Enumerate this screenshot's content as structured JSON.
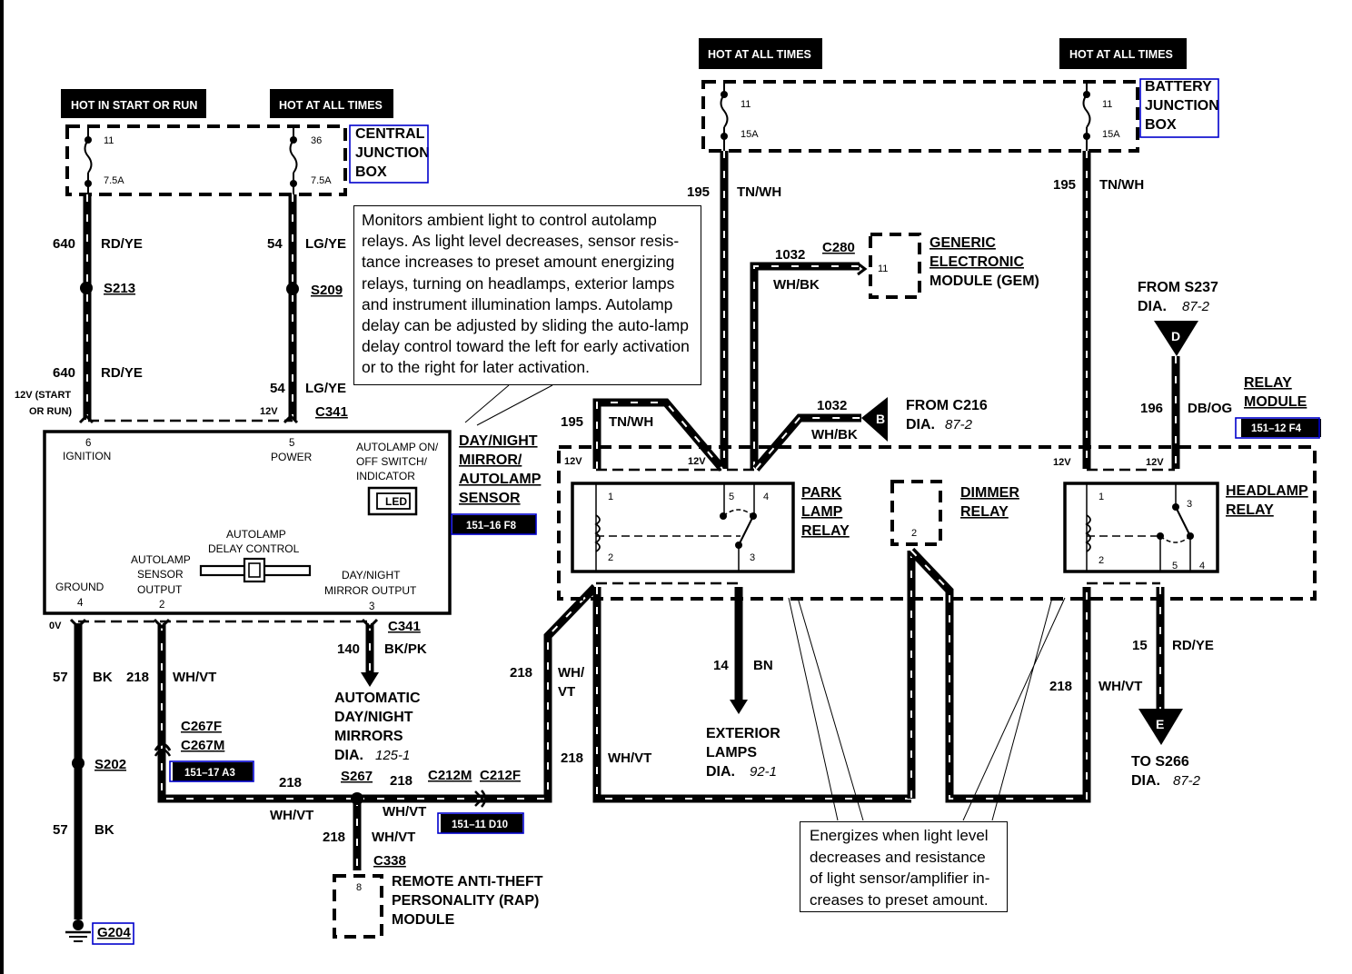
{
  "diagram": {
    "type": "automotive wiring schematic",
    "subject": "Autolamp / Day-Night Mirror / Autolamp Sensor circuit"
  },
  "power_labels": {
    "hot_start_run": "HOT IN START OR RUN",
    "hot_all_times_1": "HOT AT ALL TIMES",
    "hot_all_times_2": "HOT AT ALL TIMES",
    "hot_all_times_3": "HOT AT ALL TIMES"
  },
  "central_junction_box": {
    "name_lines": [
      "CENTRAL",
      "JUNCTION",
      "BOX"
    ],
    "fuses": [
      {
        "number": "11",
        "rating": "7.5A"
      },
      {
        "number": "36",
        "rating": "7.5A"
      }
    ]
  },
  "battery_junction_box": {
    "name_lines": [
      "BATTERY",
      "JUNCTION",
      "BOX"
    ],
    "fuses": [
      {
        "number": "11",
        "rating": "15A"
      },
      {
        "number": "11",
        "rating": "15A"
      }
    ]
  },
  "wires": {
    "w640_top": {
      "circuit": "640",
      "color": "RD/YE"
    },
    "w640_bot": {
      "circuit": "640",
      "color": "RD/YE"
    },
    "w54_top": {
      "circuit": "54",
      "color": "LG/YE"
    },
    "w54_bot": {
      "circuit": "54",
      "color": "LG/YE"
    },
    "w195_left": {
      "circuit": "195",
      "color": "TN/WH"
    },
    "w195_right": {
      "circuit": "195",
      "color": "TN/WH"
    },
    "w195_relay": {
      "circuit": "195",
      "color": "TN/WH"
    },
    "w1032_gem": {
      "circuit": "1032",
      "color": "WH/BK"
    },
    "w1032_b": {
      "circuit": "1032",
      "color": "WH/BK"
    },
    "w196": {
      "circuit": "196",
      "color": "DB/OG"
    },
    "w57_top": {
      "circuit": "57",
      "color": "BK"
    },
    "w57_bot": {
      "circuit": "57",
      "color": "BK"
    },
    "w218_sensor": {
      "circuit": "218",
      "color": "WH/VT"
    },
    "w140": {
      "circuit": "140",
      "color": "BK/PK"
    },
    "w218_bus_left": {
      "circuit": "218",
      "color": "WH/VT"
    },
    "w218_bus_right": {
      "circuit": "218",
      "color": "WH/VT"
    },
    "w218_rap": {
      "circuit": "218",
      "color": "WH/VT"
    },
    "w218_riser": {
      "circuit": "218",
      "color_lines": [
        "WH/",
        "VT"
      ]
    },
    "w218_park": {
      "circuit": "218",
      "color": "WH/VT"
    },
    "w14": {
      "circuit": "14",
      "color": "BN"
    },
    "w218_head": {
      "circuit": "218",
      "color": "WH/VT"
    },
    "w15": {
      "circuit": "15",
      "color": "RD/YE"
    }
  },
  "splices": {
    "s213": "S213",
    "s209": "S209",
    "s202": "S202",
    "s267": "S267"
  },
  "connectors": {
    "c341_top": "C341",
    "c341_bot": "C341",
    "c280": "C280",
    "c267f": "C267F",
    "c267m": "C267M",
    "c212m": "C212M",
    "c212f": "C212F",
    "c338": "C338"
  },
  "voltage_labels": {
    "start_run_l1": "12V (START",
    "start_run_l2": "OR RUN)",
    "v12_power": "12V",
    "v0_ground": "0V",
    "v12_park_a": "12V",
    "v12_park_b": "12V",
    "v12_head_a": "12V",
    "v12_head_b": "12V"
  },
  "sensor_module": {
    "name_lines": [
      "DAY/NIGHT",
      "MIRROR/",
      "AUTOLAMP",
      "SENSOR"
    ],
    "ref_tag": "151–16 F8",
    "pins": {
      "ignition": {
        "num": "6",
        "label": "IGNITION"
      },
      "power": {
        "num": "5",
        "label": "POWER"
      },
      "ground": {
        "num": "4",
        "label": "GROUND"
      },
      "sensor_output": {
        "num": "2",
        "label_lines": [
          "AUTOLAMP",
          "SENSOR",
          "OUTPUT"
        ]
      },
      "mirror_output": {
        "num": "3",
        "label_lines": [
          "DAY/NIGHT",
          "MIRROR  OUTPUT"
        ]
      }
    },
    "switch_label_lines": [
      "AUTOLAMP ON/",
      "OFF SWITCH/",
      "INDICATOR"
    ],
    "led_label": "LED",
    "delay_label_lines": [
      "AUTOLAMP",
      "DELAY  CONTROL"
    ]
  },
  "notes": {
    "sensor_note": "Monitors ambient light to control autolamp relays. As light level decreases, sensor resis-tance increases to preset amount energizing relays, turning on headlamps, exterior lamps and instrument illumination lamps. Autolamp delay  can be adjusted by sliding the auto-lamp delay control toward the left for early activation or to the right for later activation.",
    "relay_note": "Energizes when light level decreases and resistance of light sensor/amplifier in-creases to preset amount."
  },
  "gem": {
    "name_lines": [
      "GENERIC",
      "ELECTRONIC",
      "MODULE (GEM)"
    ],
    "pin": "11"
  },
  "relay_module": {
    "name_lines": [
      "RELAY",
      "MODULE"
    ],
    "ref_tag": "151–12 F4",
    "park_lamp_relay": {
      "name_lines": [
        "PARK",
        "LAMP",
        "RELAY"
      ],
      "pins": [
        "1",
        "2",
        "5",
        "4",
        "3"
      ]
    },
    "dimmer_relay": {
      "name_lines": [
        "DIMMER",
        "RELAY"
      ],
      "pin": "2"
    },
    "headlamp_relay": {
      "name_lines": [
        "HEADLAMP",
        "RELAY"
      ],
      "pins": [
        "1",
        "2",
        "3",
        "5",
        "4"
      ]
    }
  },
  "off_page": {
    "b": {
      "letter": "B",
      "from": "FROM C216",
      "dia": "DIA.",
      "page": "87-2"
    },
    "d": {
      "letter": "D",
      "from": "FROM S237",
      "dia": "DIA.",
      "page": "87-2"
    },
    "e": {
      "letter": "E",
      "to": "TO S266",
      "dia": "DIA.",
      "page": "87-2"
    }
  },
  "destinations": {
    "mirrors": {
      "name_lines": [
        "AUTOMATIC",
        "DAY/NIGHT",
        "MIRRORS"
      ],
      "dia": "DIA.",
      "page": "125-1"
    },
    "exterior": {
      "name_lines": [
        "EXTERIOR",
        "LAMPS"
      ],
      "dia": "DIA.",
      "page": "92-1"
    },
    "rap": {
      "name_lines": [
        "REMOTE ANTI-THEFT",
        "PERSONALITY (RAP)",
        "MODULE"
      ],
      "pin": "8"
    }
  },
  "ground": {
    "name": "G204"
  },
  "ref_tags": {
    "c267": "151–17 A3",
    "c212": "151–11 D10"
  },
  "colors": {
    "ink": "#000000",
    "highlight_box": "#0000cc",
    "background": "#ffffff"
  }
}
